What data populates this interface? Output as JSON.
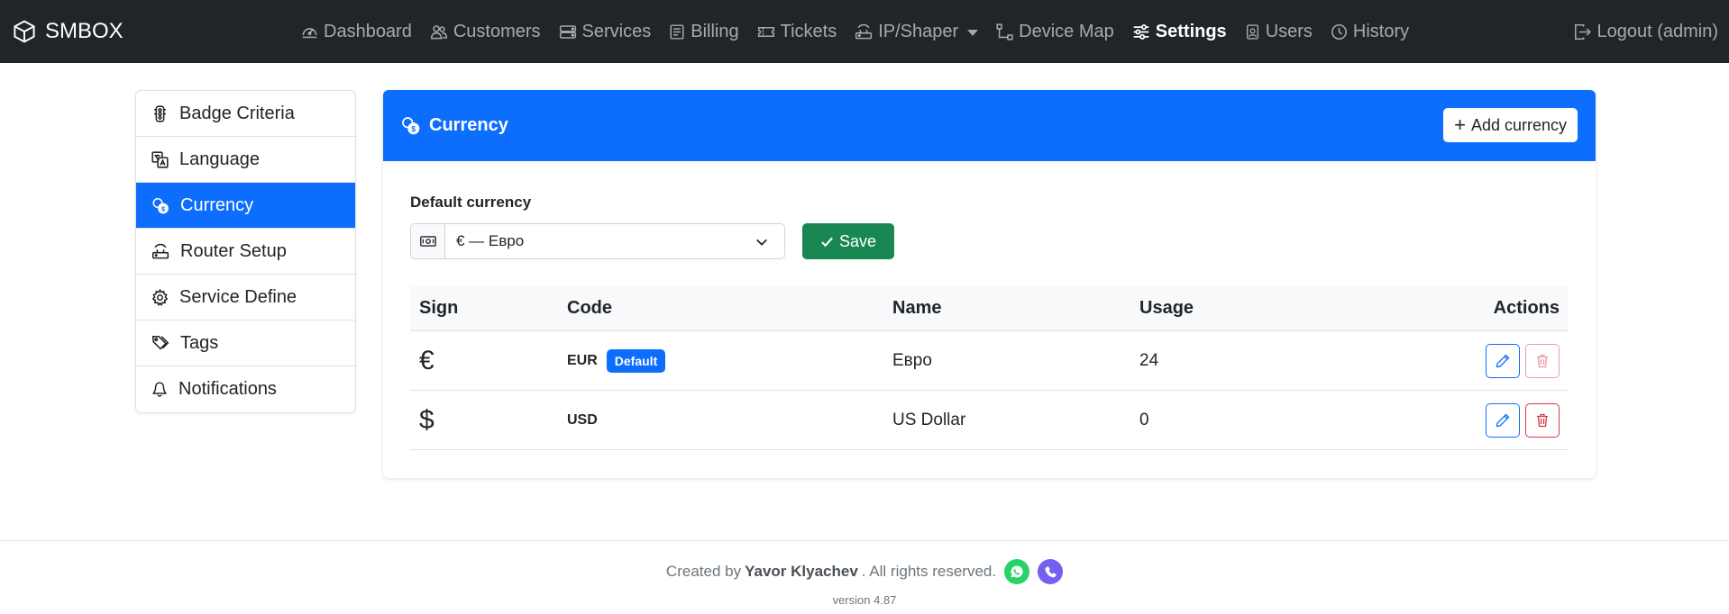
{
  "brand": {
    "name": "SMBOX"
  },
  "nav": {
    "items": [
      {
        "label": "Dashboard",
        "icon": "speedometer-icon",
        "active": false
      },
      {
        "label": "Customers",
        "icon": "people-icon",
        "active": false
      },
      {
        "label": "Services",
        "icon": "hdd-stack-icon",
        "active": false
      },
      {
        "label": "Billing",
        "icon": "receipt-icon",
        "active": false
      },
      {
        "label": "Tickets",
        "icon": "ticket-icon",
        "active": false
      },
      {
        "label": "IP/Shaper",
        "icon": "router-icon",
        "active": false,
        "dropdown": true
      },
      {
        "label": "Device Map",
        "icon": "diagram-icon",
        "active": false
      },
      {
        "label": "Settings",
        "icon": "sliders-icon",
        "active": true
      },
      {
        "label": "Users",
        "icon": "person-badge-icon",
        "active": false
      },
      {
        "label": "History",
        "icon": "clock-history-icon",
        "active": false
      }
    ],
    "logout_label": "Logout (admin)"
  },
  "sidebar": {
    "items": [
      {
        "label": "Badge Criteria",
        "icon": "traffic-light-icon",
        "active": false
      },
      {
        "label": "Language",
        "icon": "translate-icon",
        "active": false
      },
      {
        "label": "Currency",
        "icon": "coins-icon",
        "active": true
      },
      {
        "label": "Router Setup",
        "icon": "router-icon",
        "active": false
      },
      {
        "label": "Service Define",
        "icon": "gear-icon",
        "active": false
      },
      {
        "label": "Tags",
        "icon": "tags-icon",
        "active": false
      },
      {
        "label": "Notifications",
        "icon": "bell-icon",
        "active": false
      }
    ]
  },
  "currency_card": {
    "title": "Currency",
    "add_button": "Add currency",
    "default_label": "Default currency",
    "default_value": "€ — Евро",
    "save_button": "Save",
    "table": {
      "headers": {
        "sign": "Sign",
        "code": "Code",
        "name": "Name",
        "usage": "Usage",
        "actions": "Actions"
      },
      "rows": [
        {
          "sign": "€",
          "code": "EUR",
          "badge": "Default",
          "name": "Евро",
          "usage": "24",
          "delete_enabled": false
        },
        {
          "sign": "$",
          "code": "USD",
          "badge": null,
          "name": "US Dollar",
          "usage": "0",
          "delete_enabled": true
        }
      ]
    }
  },
  "footer": {
    "created_by": "Created by",
    "author": "Yavor Klyachev",
    "rights": ". All rights reserved.",
    "version": "version 4.87"
  },
  "colors": {
    "navbar": "#212529",
    "primary": "#0d6efd",
    "success": "#198754",
    "danger": "#dc3545",
    "whatsapp": "#25d366",
    "viber": "#7360f2"
  }
}
